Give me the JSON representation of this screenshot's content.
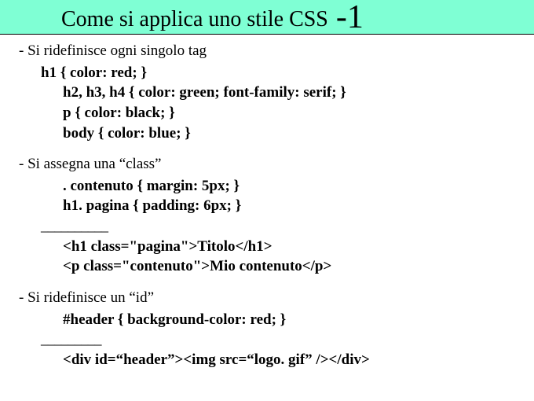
{
  "title": {
    "main": "Come si applica uno stile CSS",
    "suffix": "-1"
  },
  "section1": {
    "heading": "- Si ridefinisce ogni singolo tag",
    "line1": "h1 { color: red; }",
    "line2": "h2, h3, h4 { color: green; font-family: serif; }",
    "line3": "p { color: black; }",
    "line4": "body { color: blue; }"
  },
  "section2": {
    "heading": "- Si assegna una “class”",
    "line1": ". contenuto { margin: 5px; }",
    "line2": "h1. pagina { padding: 6px; }",
    "sep": "__________",
    "line3": "<h1 class=\"pagina\">Titolo</h1>",
    "line4": "<p class=\"contenuto\">Mio contenuto</p>"
  },
  "section3": {
    "heading": "- Si ridefinisce un “id”",
    "line1": "#header { background-color: red; }",
    "sep": "_________",
    "line2": "<div id=“header”><img src=“logo. gif” /></div>"
  }
}
